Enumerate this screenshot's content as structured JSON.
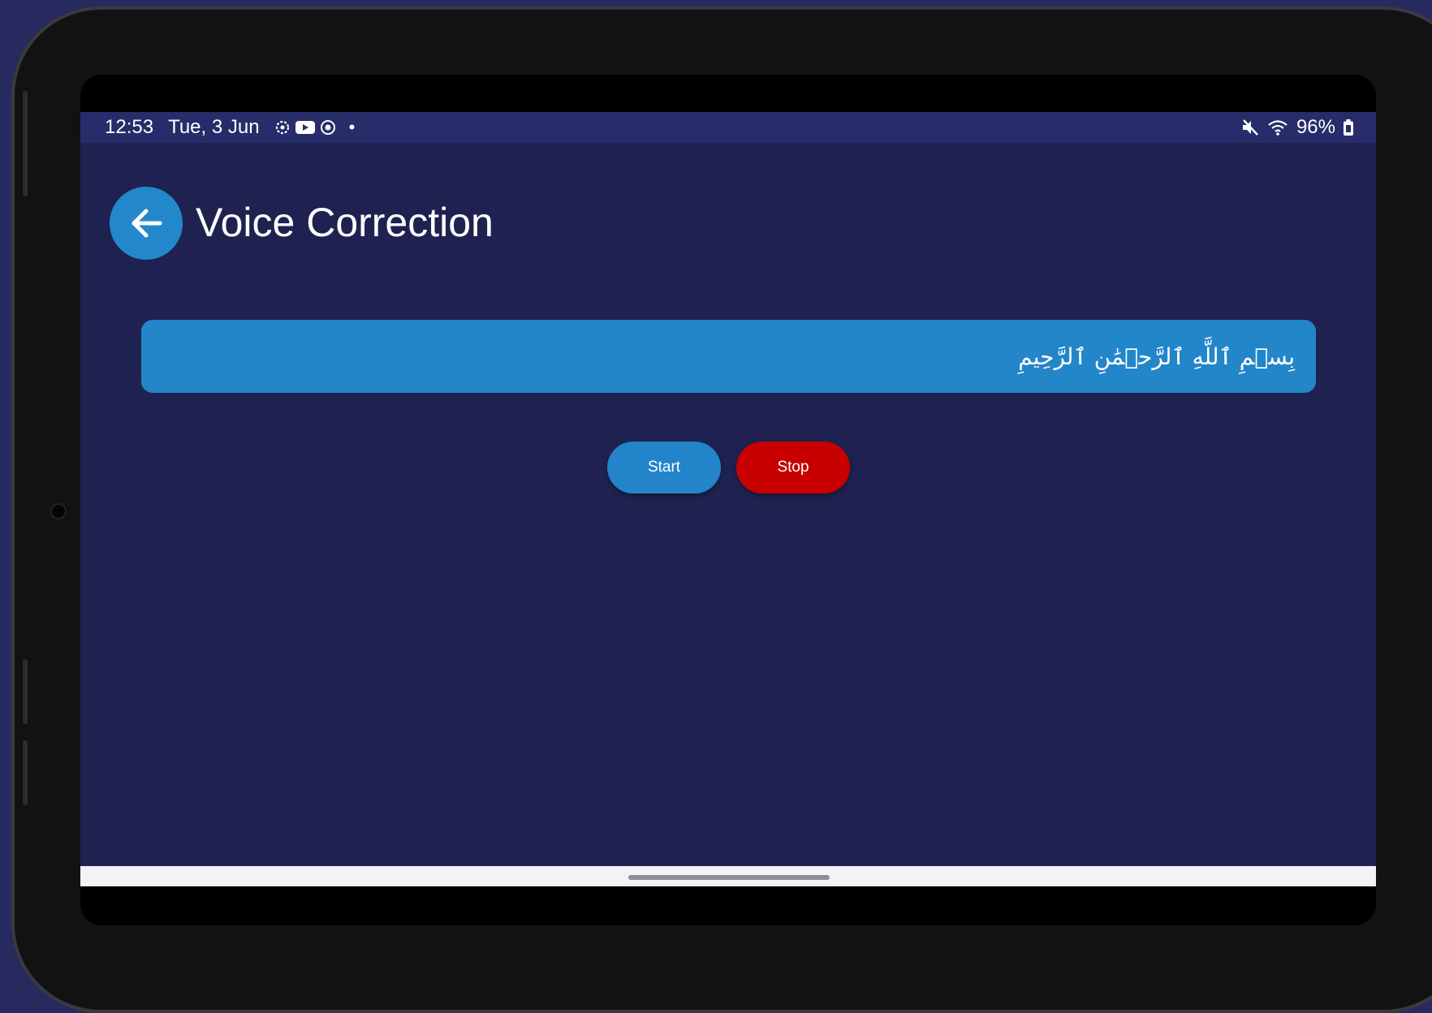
{
  "status_bar": {
    "time": "12:53",
    "date": "Tue, 3 Jun",
    "dot": "•",
    "battery": "96%",
    "left_icons": [
      "settings-icon",
      "youtube-icon",
      "screen-record-icon"
    ],
    "right_icons": [
      "mute-icon",
      "wifi-icon",
      "battery-icon"
    ]
  },
  "header": {
    "back_icon": "arrow-left-icon",
    "title": "Voice Correction"
  },
  "ayah": {
    "text": "بِسۡمِ ٱللَّهِ ٱلرَّحۡمَٰنِ ٱلرَّحِيمِ"
  },
  "controls": {
    "start_label": "Start",
    "stop_label": "Stop"
  },
  "colors": {
    "background": "#1f2250",
    "status_bar": "#272c6a",
    "accent_blue": "#2386c9",
    "stop_red": "#c80000"
  }
}
